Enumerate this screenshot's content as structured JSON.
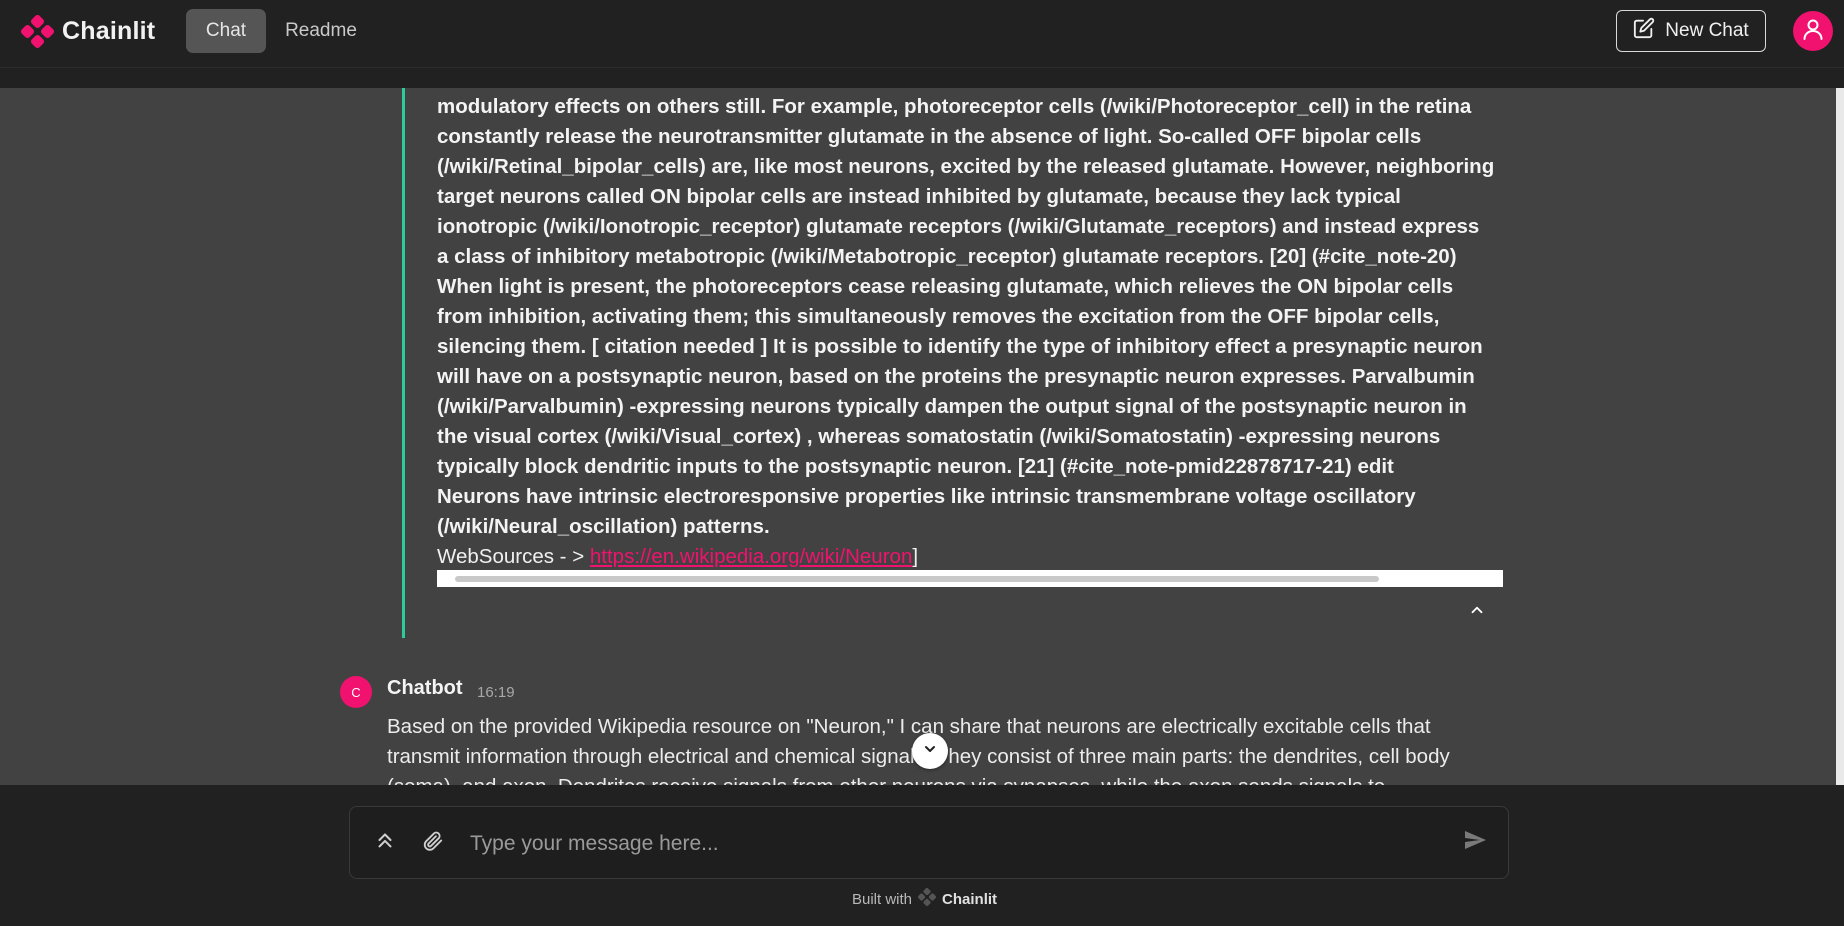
{
  "header": {
    "app_name": "Chainlit",
    "tabs": [
      {
        "label": "Chat",
        "active": true
      },
      {
        "label": "Readme",
        "active": false
      }
    ],
    "new_chat_label": "New Chat",
    "brand_color": "#f0126e"
  },
  "step": {
    "lines": [
      "modulatory effects on others still. For example, photoreceptor cells (/wiki/Photoreceptor_cell) in the retina",
      "constantly release the neurotransmitter glutamate in the absence of light. So-called OFF bipolar cells",
      "(/wiki/Retinal_bipolar_cells) are, like most neurons, excited by the released glutamate. However, neighboring",
      "target neurons called ON bipolar cells are instead inhibited by glutamate, because they lack typical",
      "ionotropic (/wiki/Ionotropic_receptor) glutamate receptors (/wiki/Glutamate_receptors) and instead express",
      "a class of inhibitory metabotropic (/wiki/Metabotropic_receptor) glutamate receptors. [20] (#cite_note-20)",
      "When light is present, the photoreceptors cease releasing glutamate, which relieves the ON bipolar cells",
      "from inhibition, activating them; this simultaneously removes the excitation from the OFF bipolar cells,",
      "silencing them. [ citation needed ] It is possible to identify the type of inhibitory effect a presynaptic neuron",
      "will have on a postsynaptic neuron, based on the proteins the presynaptic neuron expresses. Parvalbumin",
      "(/wiki/Parvalbumin) -expressing neurons typically dampen the output signal of the postsynaptic neuron in",
      "the visual cortex (/wiki/Visual_cortex) , whereas somatostatin (/wiki/Somatostatin) -expressing neurons",
      "typically block dendritic inputs to the postsynaptic neuron. [21] (#cite_note-pmid22878717-21) edit",
      "Neurons have intrinsic electroresponsive properties like intrinsic transmembrane voltage oscillatory",
      "(/wiki/Neural_oscillation) patterns."
    ],
    "websources_prefix": "WebSources - > ",
    "websources_link": "https://en.wikipedia.org/wiki/Neuron",
    "websources_suffix": "]",
    "accent_color": "#2ecc9a"
  },
  "message": {
    "avatar_letter": "C",
    "author": "Chatbot",
    "time": "16:19",
    "text": "Based on the provided Wikipedia resource on \"Neuron,\" I can share that neurons are electrically excitable cells that transmit information through electrical and chemical signals. They consist of three main parts: the dendrites, cell body (soma), and axon. Dendrites receive signals from other neurons via synapses, while the axon sends signals to"
  },
  "composer": {
    "placeholder": "Type your message here..."
  },
  "footer": {
    "built_with": "Built with",
    "brand": "Chainlit"
  }
}
